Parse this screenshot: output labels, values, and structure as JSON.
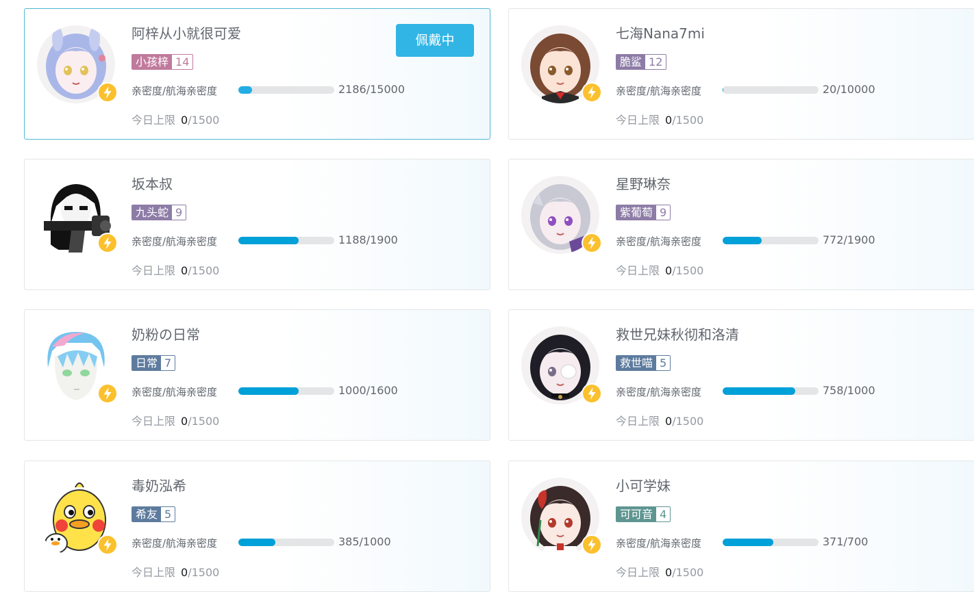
{
  "labels": {
    "affinity": "亲密度/航海亲密度",
    "daily_limit": "今日上限",
    "wearing_button": "佩戴中"
  },
  "colors": {
    "accent": "#30b5e4",
    "progress": "#00a0d8",
    "active_border": "#52b7d4",
    "bolt": "#fbc02d"
  },
  "cards": [
    {
      "name": "阿梓从小就很可爱",
      "medal": "小孩梓",
      "level": "14",
      "medal_color": "#c07a9c",
      "affinity": "2186/15000",
      "progress": 0.146,
      "today_current": "0",
      "today_max": "/1500",
      "wearing": true,
      "avatar": "anime-girl-bunny-avatar"
    },
    {
      "name": "七海Nana7mi",
      "medal": "脆鲨",
      "level": "12",
      "medal_color": "#8d7ca6",
      "affinity": "20/10000",
      "progress": 0.002,
      "today_current": "0",
      "today_max": "/1500",
      "wearing": false,
      "avatar": "anime-girl-brown-hair-avatar"
    },
    {
      "name": "坂本叔",
      "medal": "九头蛇",
      "level": "9",
      "medal_color": "#8d7ca6",
      "affinity": "1188/1900",
      "progress": 0.625,
      "today_current": "0",
      "today_max": "/1500",
      "wearing": false,
      "avatar": "manga-gunner-avatar"
    },
    {
      "name": "星野琳奈",
      "medal": "紫葡萄",
      "level": "9",
      "medal_color": "#8d7ca6",
      "affinity": "772/1900",
      "progress": 0.406,
      "today_current": "0",
      "today_max": "/1500",
      "wearing": false,
      "avatar": "anime-girl-silver-hair-avatar"
    },
    {
      "name": "奶粉の日常",
      "medal": "日常",
      "level": "7",
      "medal_color": "#5d7b9e",
      "affinity": "1000/1600",
      "progress": 0.625,
      "today_current": "0",
      "today_max": "/1500",
      "wearing": false,
      "avatar": "anime-boy-blue-hair-avatar"
    },
    {
      "name": "救世兄妹秋彻和洛清",
      "medal": "救世喵",
      "level": "5",
      "medal_color": "#5d7b9e",
      "affinity": "758/1000",
      "progress": 0.758,
      "today_current": "0",
      "today_max": "/1500",
      "wearing": false,
      "avatar": "anime-girl-eyepatch-avatar"
    },
    {
      "name": "毒奶泓希",
      "medal": "希友",
      "level": "5",
      "medal_color": "#5d7b9e",
      "affinity": "385/1000",
      "progress": 0.385,
      "today_current": "0",
      "today_max": "/1500",
      "wearing": false,
      "avatar": "yellow-duck-avatar"
    },
    {
      "name": "小可学妹",
      "medal": "可可音",
      "level": "4",
      "medal_color": "#5e9590",
      "affinity": "371/700",
      "progress": 0.53,
      "today_current": "0",
      "today_max": "/1500",
      "wearing": false,
      "avatar": "anime-girl-red-hair-avatar"
    }
  ]
}
